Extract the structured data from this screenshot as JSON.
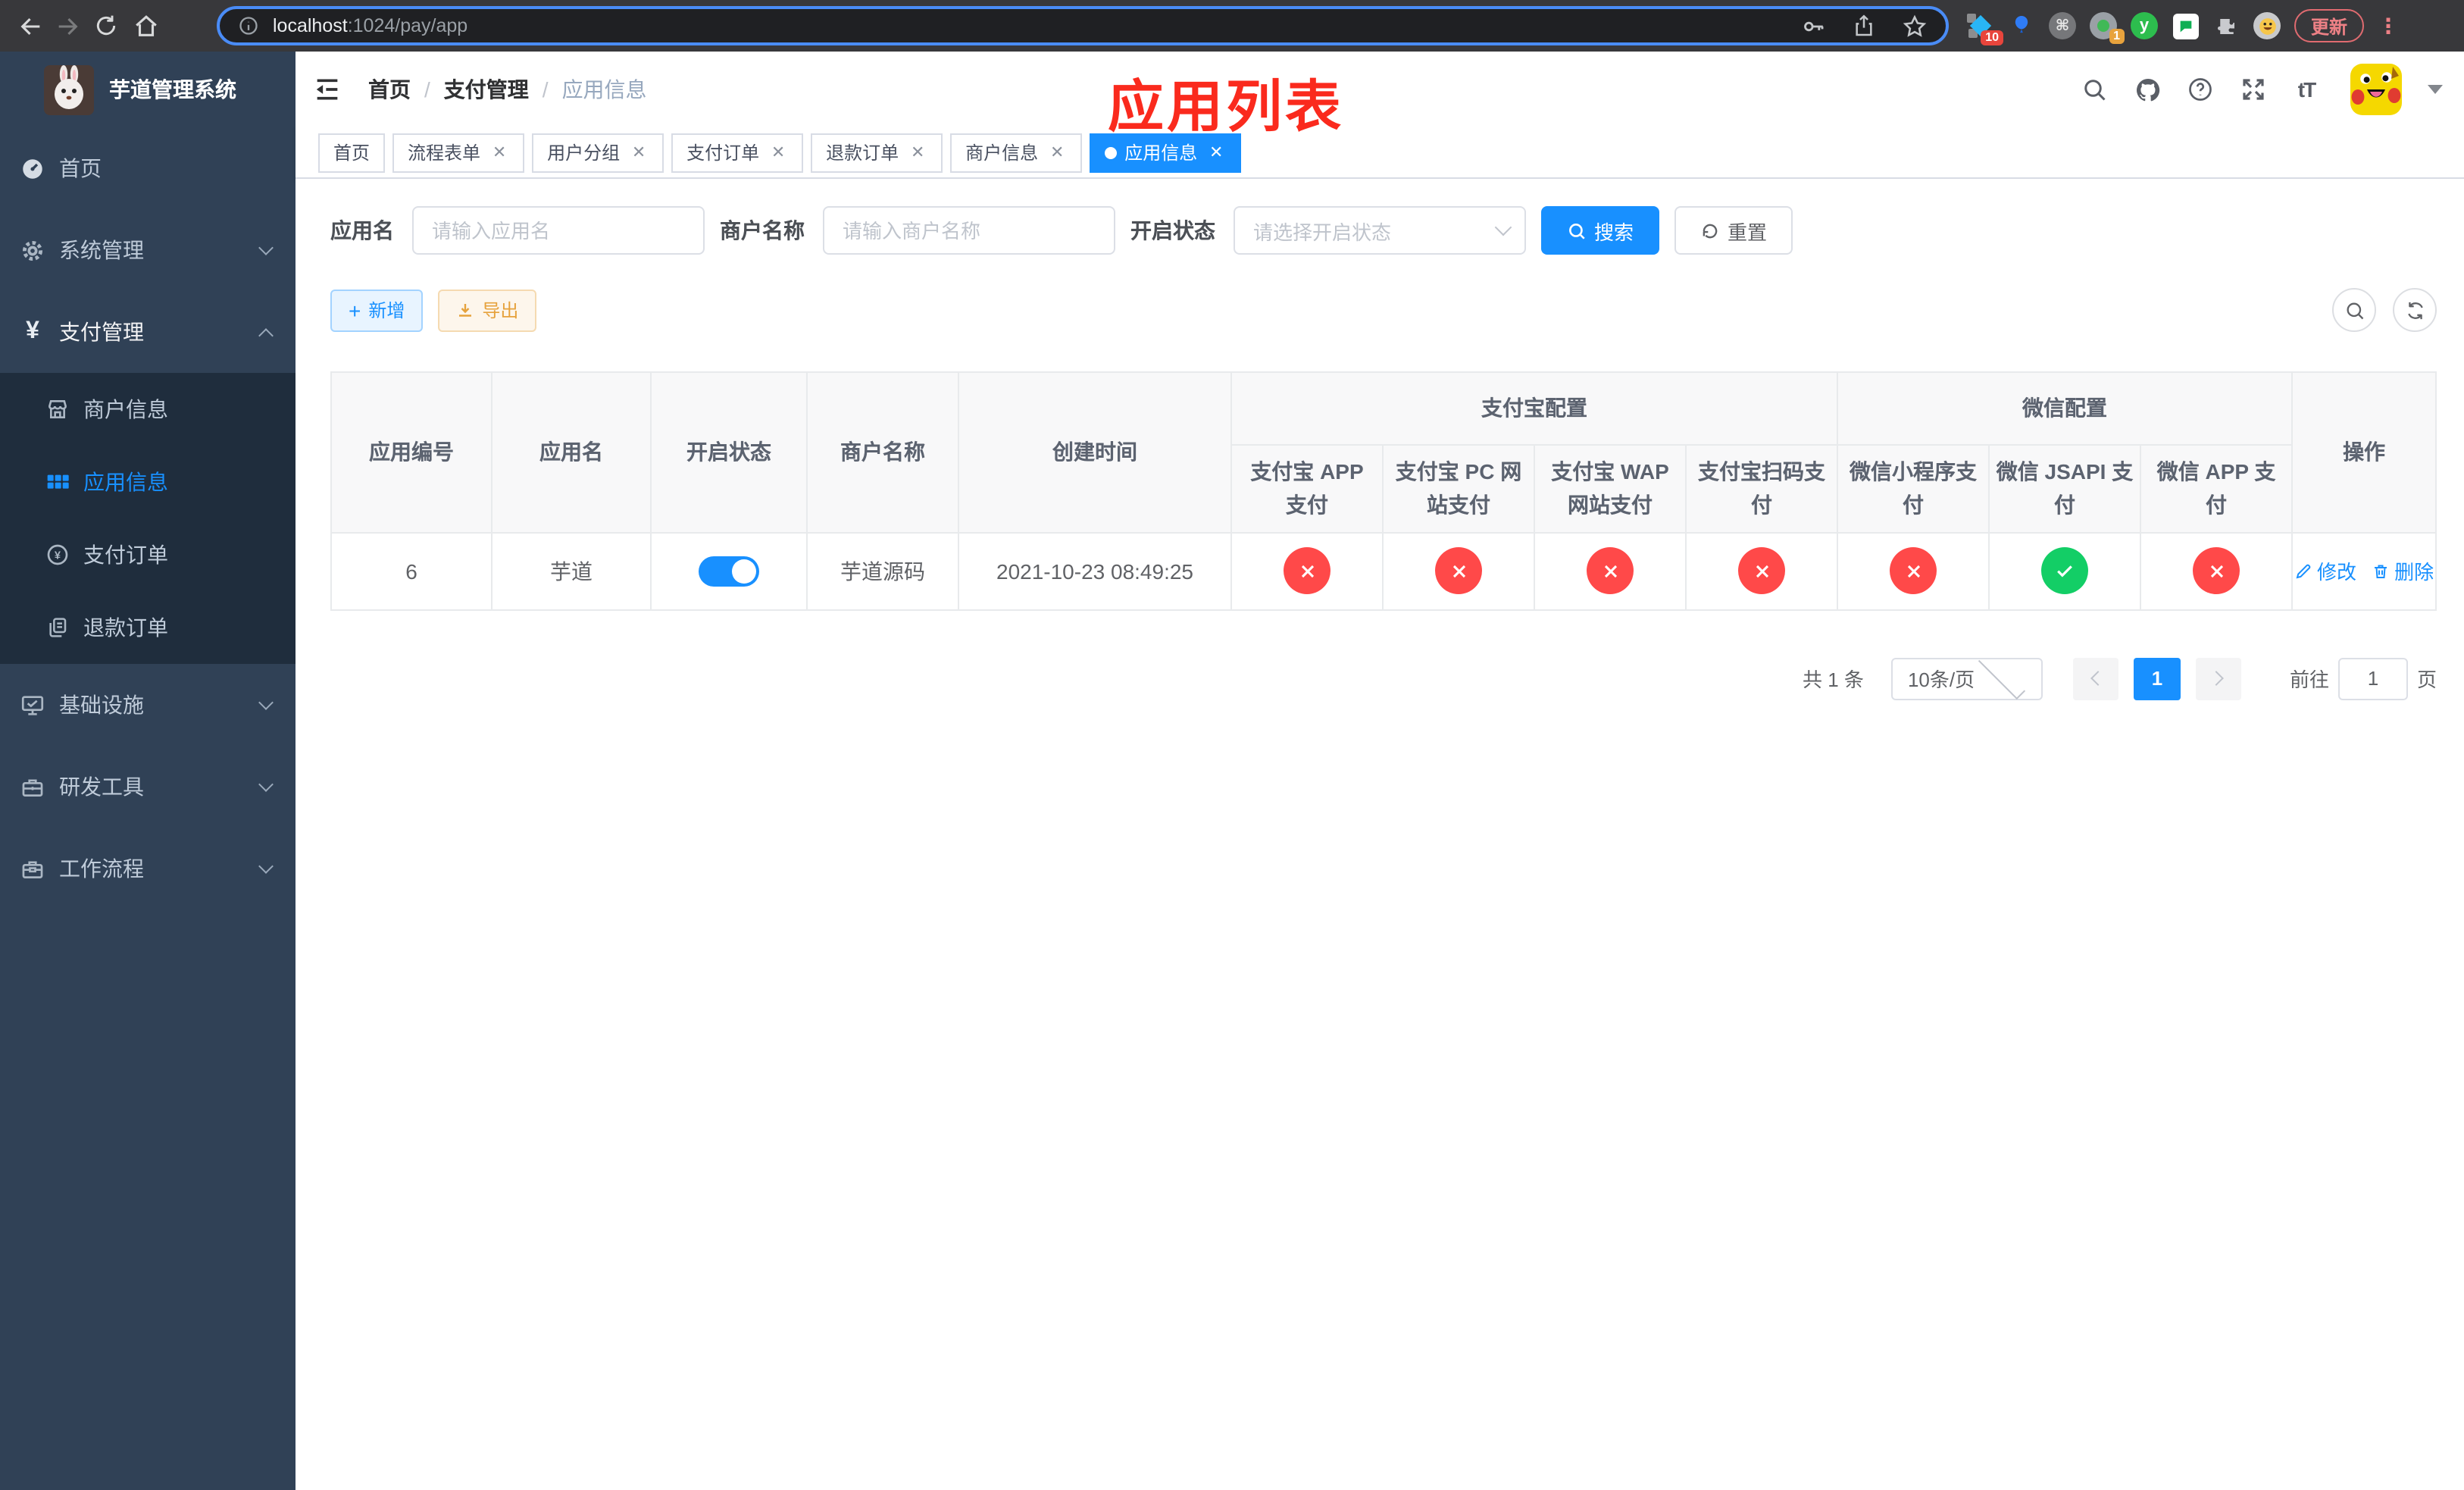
{
  "browser": {
    "url_host": "localhost",
    "url_path": ":1024/pay/app",
    "update_label": "更新",
    "ext_badge_1": "10",
    "ext_badge_2": "1",
    "icons": [
      "back-icon",
      "forward-icon",
      "reload-icon",
      "home-icon",
      "info-icon",
      "key-icon",
      "share-icon",
      "star-icon",
      "diamond-extension-icon",
      "balloon-extension-icon",
      "command-extension-icon",
      "profile-extension-icon",
      "y-extension-icon",
      "chat-extension-icon",
      "puzzle-icon",
      "emoji-extension-icon",
      "kebab-menu-icon"
    ]
  },
  "annotation": {
    "text": "应用列表",
    "color": "#fa2a1d"
  },
  "sidebar": {
    "title": "芋道管理系统",
    "items": [
      {
        "label": "首页",
        "icon": "dashboard-icon"
      },
      {
        "label": "系统管理",
        "icon": "gear-icon",
        "arrow": "down"
      },
      {
        "label": "支付管理",
        "icon": "yen-icon",
        "arrow": "up"
      },
      {
        "label": "商户信息",
        "icon": "shop-icon",
        "sub": true
      },
      {
        "label": "应用信息",
        "icon": "grid-icon",
        "sub": true,
        "active": true
      },
      {
        "label": "支付订单",
        "icon": "yen-circle-icon",
        "sub": true
      },
      {
        "label": "退款订单",
        "icon": "documents-icon",
        "sub": true
      },
      {
        "label": "基础设施",
        "icon": "monitor-icon",
        "arrow": "down"
      },
      {
        "label": "研发工具",
        "icon": "toolbox-icon",
        "arrow": "down"
      },
      {
        "label": "工作流程",
        "icon": "workflow-icon",
        "arrow": "down"
      }
    ]
  },
  "breadcrumb": {
    "items": [
      "首页",
      "支付管理",
      "应用信息"
    ],
    "separator": "/"
  },
  "tabs": [
    {
      "label": "首页",
      "closable": false,
      "active": false
    },
    {
      "label": "流程表单",
      "closable": true,
      "active": false
    },
    {
      "label": "用户分组",
      "closable": true,
      "active": false
    },
    {
      "label": "支付订单",
      "closable": true,
      "active": false
    },
    {
      "label": "退款订单",
      "closable": true,
      "active": false
    },
    {
      "label": "商户信息",
      "closable": true,
      "active": false
    },
    {
      "label": "应用信息",
      "closable": true,
      "active": true
    }
  ],
  "filters": {
    "app_name": {
      "label": "应用名",
      "placeholder": "请输入应用名",
      "value": ""
    },
    "merchant_name": {
      "label": "商户名称",
      "placeholder": "请输入商户名称",
      "value": ""
    },
    "status": {
      "label": "开启状态",
      "placeholder": "请选择开启状态",
      "value": ""
    },
    "search_label": "搜索",
    "reset_label": "重置"
  },
  "toolbar": {
    "add_label": "新增",
    "export_label": "导出"
  },
  "table": {
    "plain_columns": [
      "应用编号",
      "应用名",
      "开启状态",
      "商户名称",
      "创建时间"
    ],
    "groups": [
      {
        "label": "支付宝配置",
        "children": [
          "支付宝 APP 支付",
          "支付宝 PC 网站支付",
          "支付宝 WAP 网站支付",
          "支付宝扫码支付"
        ]
      },
      {
        "label": "微信配置",
        "children": [
          "微信小程序支付",
          "微信 JSAPI 支付",
          "微信 APP 支付"
        ]
      }
    ],
    "op_column": "操作",
    "rows": [
      {
        "id": "6",
        "name": "芋道",
        "enabled": true,
        "merchant": "芋道源码",
        "created": "2021-10-23 08:49:25",
        "statuses": [
          false,
          false,
          false,
          false,
          false,
          true,
          false
        ],
        "edit_label": "修改",
        "delete_label": "删除"
      }
    ]
  },
  "pagination": {
    "total": "共 1 条",
    "page_size": "10条/页",
    "page": "1",
    "goto": "前往",
    "goto_value": "1",
    "unit": "页"
  },
  "colors": {
    "primary": "#1890ff",
    "success": "#13ce66",
    "danger": "#ff4949",
    "warning": "#e6a23c",
    "sidebar_bg": "#304156",
    "submenu_bg": "#1f2d3d",
    "annotation_red": "#fa2a1d"
  }
}
